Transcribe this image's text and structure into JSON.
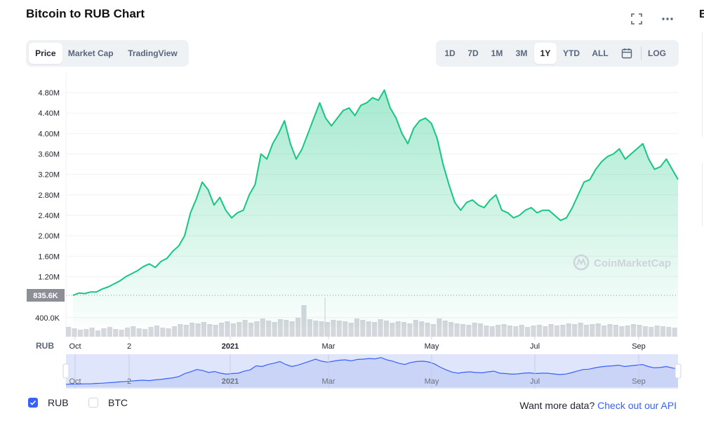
{
  "title": "Bitcoin to RUB Chart",
  "header_icons": [
    "fullscreen-icon",
    "more-icon"
  ],
  "right_edge_letter": "B",
  "view_tabs": [
    {
      "label": "Price",
      "active": true
    },
    {
      "label": "Market Cap",
      "active": false
    },
    {
      "label": "TradingView",
      "active": false
    }
  ],
  "range_tabs": [
    {
      "label": "1D",
      "active": false
    },
    {
      "label": "7D",
      "active": false
    },
    {
      "label": "1M",
      "active": false
    },
    {
      "label": "3M",
      "active": false
    },
    {
      "label": "1Y",
      "active": true
    },
    {
      "label": "YTD",
      "active": false
    },
    {
      "label": "ALL",
      "active": false
    }
  ],
  "log_label": "LOG",
  "colors": {
    "line": "#16c784",
    "brand": "#3861fb",
    "navigator_line": "#3861fb",
    "navigator_fill": "#dfe6fb",
    "price_badge": "#8c9096"
  },
  "chart_data": {
    "type": "area",
    "currency_axis_label": "RUB",
    "x_tick_labels": [
      "Oct",
      "2",
      "2021",
      "Mar",
      "May",
      "Jul",
      "Sep"
    ],
    "y_tick_labels": [
      "4.80M",
      "4.40M",
      "4.00M",
      "3.60M",
      "3.20M",
      "2.80M",
      "2.40M",
      "2.00M",
      "1.60M",
      "1.20M",
      "400.0K"
    ],
    "y_ticks": [
      4800000,
      4400000,
      4000000,
      3600000,
      3200000,
      2800000,
      2400000,
      2000000,
      1600000,
      1200000,
      400000
    ],
    "ylim": [
      0,
      5000000
    ],
    "current_price_label": "835.6K",
    "current_price": 835600,
    "watermark": "CoinMarketCap",
    "grid": true,
    "series": [
      {
        "values": [
          836000,
          880000,
          870000,
          900000,
          900000,
          960000,
          1000000,
          1060000,
          1120000,
          1200000,
          1260000,
          1320000,
          1400000,
          1450000,
          1380000,
          1500000,
          1560000,
          1700000,
          1800000,
          2000000,
          2450000,
          2720000,
          3050000,
          2900000,
          2600000,
          2750000,
          2500000,
          2350000,
          2450000,
          2500000,
          2800000,
          3000000,
          3600000,
          3500000,
          3800000,
          4000000,
          4250000,
          3800000,
          3500000,
          3700000,
          4000000,
          4300000,
          4600000,
          4300000,
          4150000,
          4300000,
          4450000,
          4500000,
          4350000,
          4550000,
          4600000,
          4700000,
          4650000,
          4850000,
          4500000,
          4300000,
          4000000,
          3800000,
          4100000,
          4250000,
          4300000,
          4200000,
          3900000,
          3400000,
          3000000,
          2650000,
          2500000,
          2650000,
          2700000,
          2600000,
          2550000,
          2700000,
          2800000,
          2500000,
          2450000,
          2350000,
          2400000,
          2500000,
          2550000,
          2450000,
          2500000,
          2500000,
          2400000,
          2300000,
          2350000,
          2550000,
          2800000,
          3050000,
          3100000,
          3300000,
          3450000,
          3550000,
          3600000,
          3700000,
          3500000,
          3600000,
          3700000,
          3800000,
          3500000,
          3300000,
          3350000,
          3500000,
          3300000,
          3100000
        ]
      }
    ],
    "volume": [
      14,
      12,
      10,
      11,
      13,
      9,
      12,
      14,
      11,
      10,
      13,
      15,
      12,
      11,
      14,
      16,
      13,
      12,
      15,
      18,
      17,
      20,
      19,
      21,
      18,
      17,
      20,
      22,
      19,
      21,
      24,
      20,
      22,
      26,
      23,
      21,
      25,
      24,
      22,
      27,
      45,
      25,
      23,
      22,
      21,
      24,
      23,
      22,
      20,
      26,
      24,
      22,
      21,
      25,
      23,
      20,
      22,
      21,
      19,
      24,
      22,
      20,
      18,
      26,
      23,
      21,
      19,
      18,
      17,
      20,
      19,
      16,
      15,
      17,
      18,
      16,
      15,
      17,
      14,
      16,
      17,
      15,
      18,
      16,
      17,
      19,
      18,
      20,
      17,
      18,
      19,
      16,
      18,
      17,
      15,
      16,
      18,
      17,
      15,
      14,
      16,
      15,
      14,
      13
    ]
  },
  "bottom": {
    "checkboxes": [
      {
        "label": "RUB",
        "checked": true
      },
      {
        "label": "BTC",
        "checked": false
      }
    ],
    "api_prompt": "Want more data?",
    "api_link": "Check out our API"
  }
}
